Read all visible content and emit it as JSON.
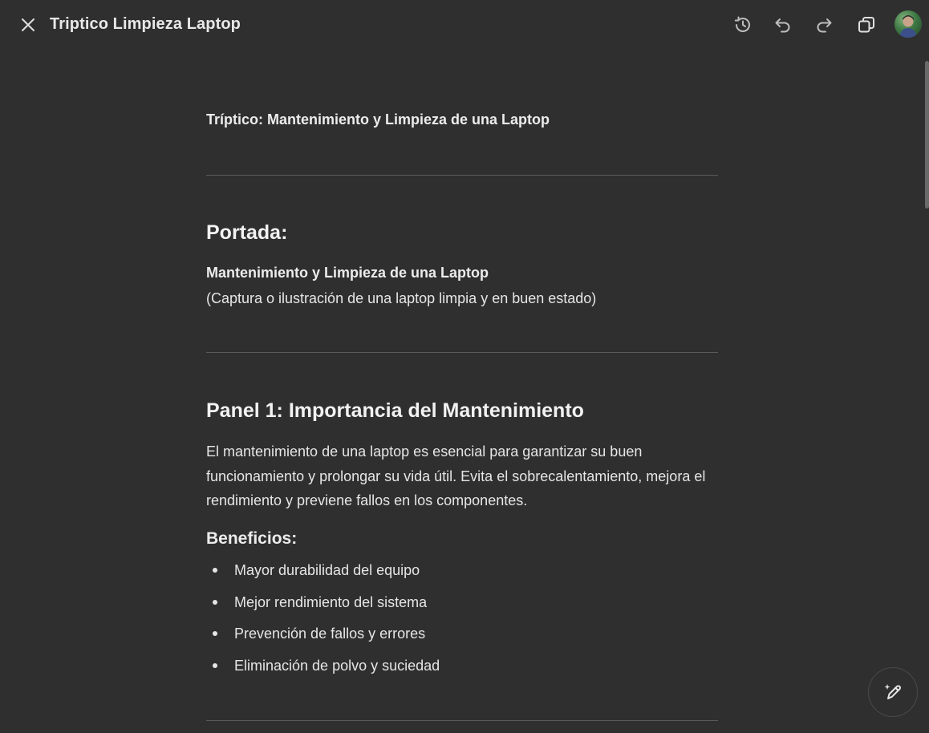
{
  "header": {
    "title": "Triptico Limpieza Laptop",
    "icons": [
      "close-icon",
      "history-icon",
      "undo-icon",
      "redo-icon",
      "copy-icon",
      "avatar"
    ]
  },
  "document": {
    "heading": "Tríptico: Mantenimiento y Limpieza de una Laptop",
    "portada": {
      "title": "Portada:",
      "subtitle": "Mantenimiento y Limpieza de una Laptop",
      "note": "(Captura o ilustración de una laptop limpia y en buen estado)"
    },
    "panel1": {
      "title": "Panel 1: Importancia del Mantenimiento",
      "paragraph": "El mantenimiento de una laptop es esencial para garantizar su buen funcionamiento y prolongar su vida útil. Evita el sobrecalentamiento, mejora el rendimiento y previene fallos en los componentes.",
      "benefits_title": "Beneficios:",
      "benefits": [
        "Mayor durabilidad del equipo",
        "Mejor rendimiento del sistema",
        "Prevención de fallos y errores",
        "Eliminación de polvo y suciedad"
      ]
    }
  },
  "fab": {
    "icon": "edit-sparkle-icon"
  },
  "colors": {
    "background": "#2f2f2f",
    "text": "#ececec",
    "divider": "#5a5a5a"
  }
}
